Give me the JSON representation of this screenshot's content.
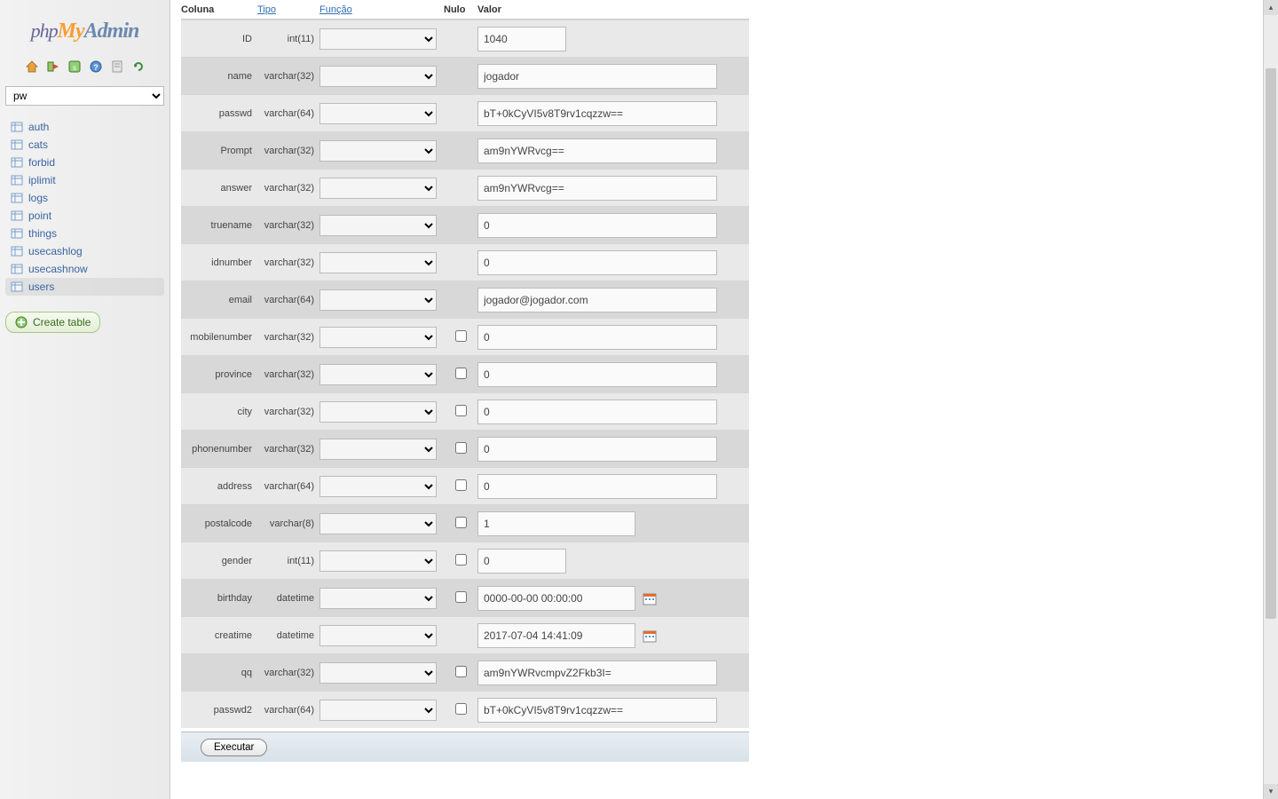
{
  "logo": {
    "part1": "php",
    "part2": "My",
    "part3": "Admin"
  },
  "db_selected": "pw",
  "tables": [
    "auth",
    "cats",
    "forbid",
    "iplimit",
    "logs",
    "point",
    "things",
    "usecashlog",
    "usecashnow",
    "users"
  ],
  "selected_table_index": 9,
  "create_table_label": "Create table",
  "headers": {
    "col": "Coluna",
    "type": "Tipo",
    "func": "Função",
    "null": "Nulo",
    "value": "Valor"
  },
  "rows": [
    {
      "name": "ID",
      "type": "int(11)",
      "null_cb": false,
      "value": "1040",
      "width": "short",
      "cal": false,
      "zebra": "odd"
    },
    {
      "name": "name",
      "type": "varchar(32)",
      "null_cb": false,
      "value": "jogador",
      "width": "wide",
      "cal": false,
      "zebra": "even"
    },
    {
      "name": "passwd",
      "type": "varchar(64)",
      "null_cb": false,
      "value": "bT+0kCyVI5v8T9rv1cqzzw==",
      "width": "wide",
      "cal": false,
      "zebra": "odd"
    },
    {
      "name": "Prompt",
      "type": "varchar(32)",
      "null_cb": false,
      "value": "am9nYWRvcg==",
      "width": "wide",
      "cal": false,
      "zebra": "even"
    },
    {
      "name": "answer",
      "type": "varchar(32)",
      "null_cb": false,
      "value": "am9nYWRvcg==",
      "width": "wide",
      "cal": false,
      "zebra": "odd"
    },
    {
      "name": "truename",
      "type": "varchar(32)",
      "null_cb": false,
      "value": "0",
      "width": "wide",
      "cal": false,
      "zebra": "even"
    },
    {
      "name": "idnumber",
      "type": "varchar(32)",
      "null_cb": false,
      "value": "0",
      "width": "wide",
      "cal": false,
      "zebra": "odd"
    },
    {
      "name": "email",
      "type": "varchar(64)",
      "null_cb": false,
      "value": "jogador@jogador.com",
      "width": "wide",
      "cal": false,
      "zebra": "even"
    },
    {
      "name": "mobilenumber",
      "type": "varchar(32)",
      "null_cb": true,
      "value": "0",
      "width": "wide",
      "cal": false,
      "zebra": "odd"
    },
    {
      "name": "province",
      "type": "varchar(32)",
      "null_cb": true,
      "value": "0",
      "width": "wide",
      "cal": false,
      "zebra": "even"
    },
    {
      "name": "city",
      "type": "varchar(32)",
      "null_cb": true,
      "value": "0",
      "width": "wide",
      "cal": false,
      "zebra": "odd"
    },
    {
      "name": "phonenumber",
      "type": "varchar(32)",
      "null_cb": true,
      "value": "0",
      "width": "wide",
      "cal": false,
      "zebra": "even"
    },
    {
      "name": "address",
      "type": "varchar(64)",
      "null_cb": true,
      "value": "0",
      "width": "wide",
      "cal": false,
      "zebra": "odd"
    },
    {
      "name": "postalcode",
      "type": "varchar(8)",
      "null_cb": true,
      "value": "1",
      "width": "med",
      "cal": false,
      "zebra": "even"
    },
    {
      "name": "gender",
      "type": "int(11)",
      "null_cb": true,
      "value": "0",
      "width": "short",
      "cal": false,
      "zebra": "odd"
    },
    {
      "name": "birthday",
      "type": "datetime",
      "null_cb": true,
      "value": "0000-00-00 00:00:00",
      "width": "med",
      "cal": true,
      "zebra": "even"
    },
    {
      "name": "creatime",
      "type": "datetime",
      "null_cb": false,
      "value": "2017-07-04 14:41:09",
      "width": "med",
      "cal": true,
      "zebra": "odd"
    },
    {
      "name": "qq",
      "type": "varchar(32)",
      "null_cb": true,
      "value": "am9nYWRvcmpvZ2Fkb3I=",
      "width": "wide",
      "cal": false,
      "zebra": "even"
    },
    {
      "name": "passwd2",
      "type": "varchar(64)",
      "null_cb": true,
      "value": "bT+0kCyVI5v8T9rv1cqzzw==",
      "width": "wide",
      "cal": false,
      "zebra": "odd"
    }
  ],
  "execute_label": "Executar"
}
